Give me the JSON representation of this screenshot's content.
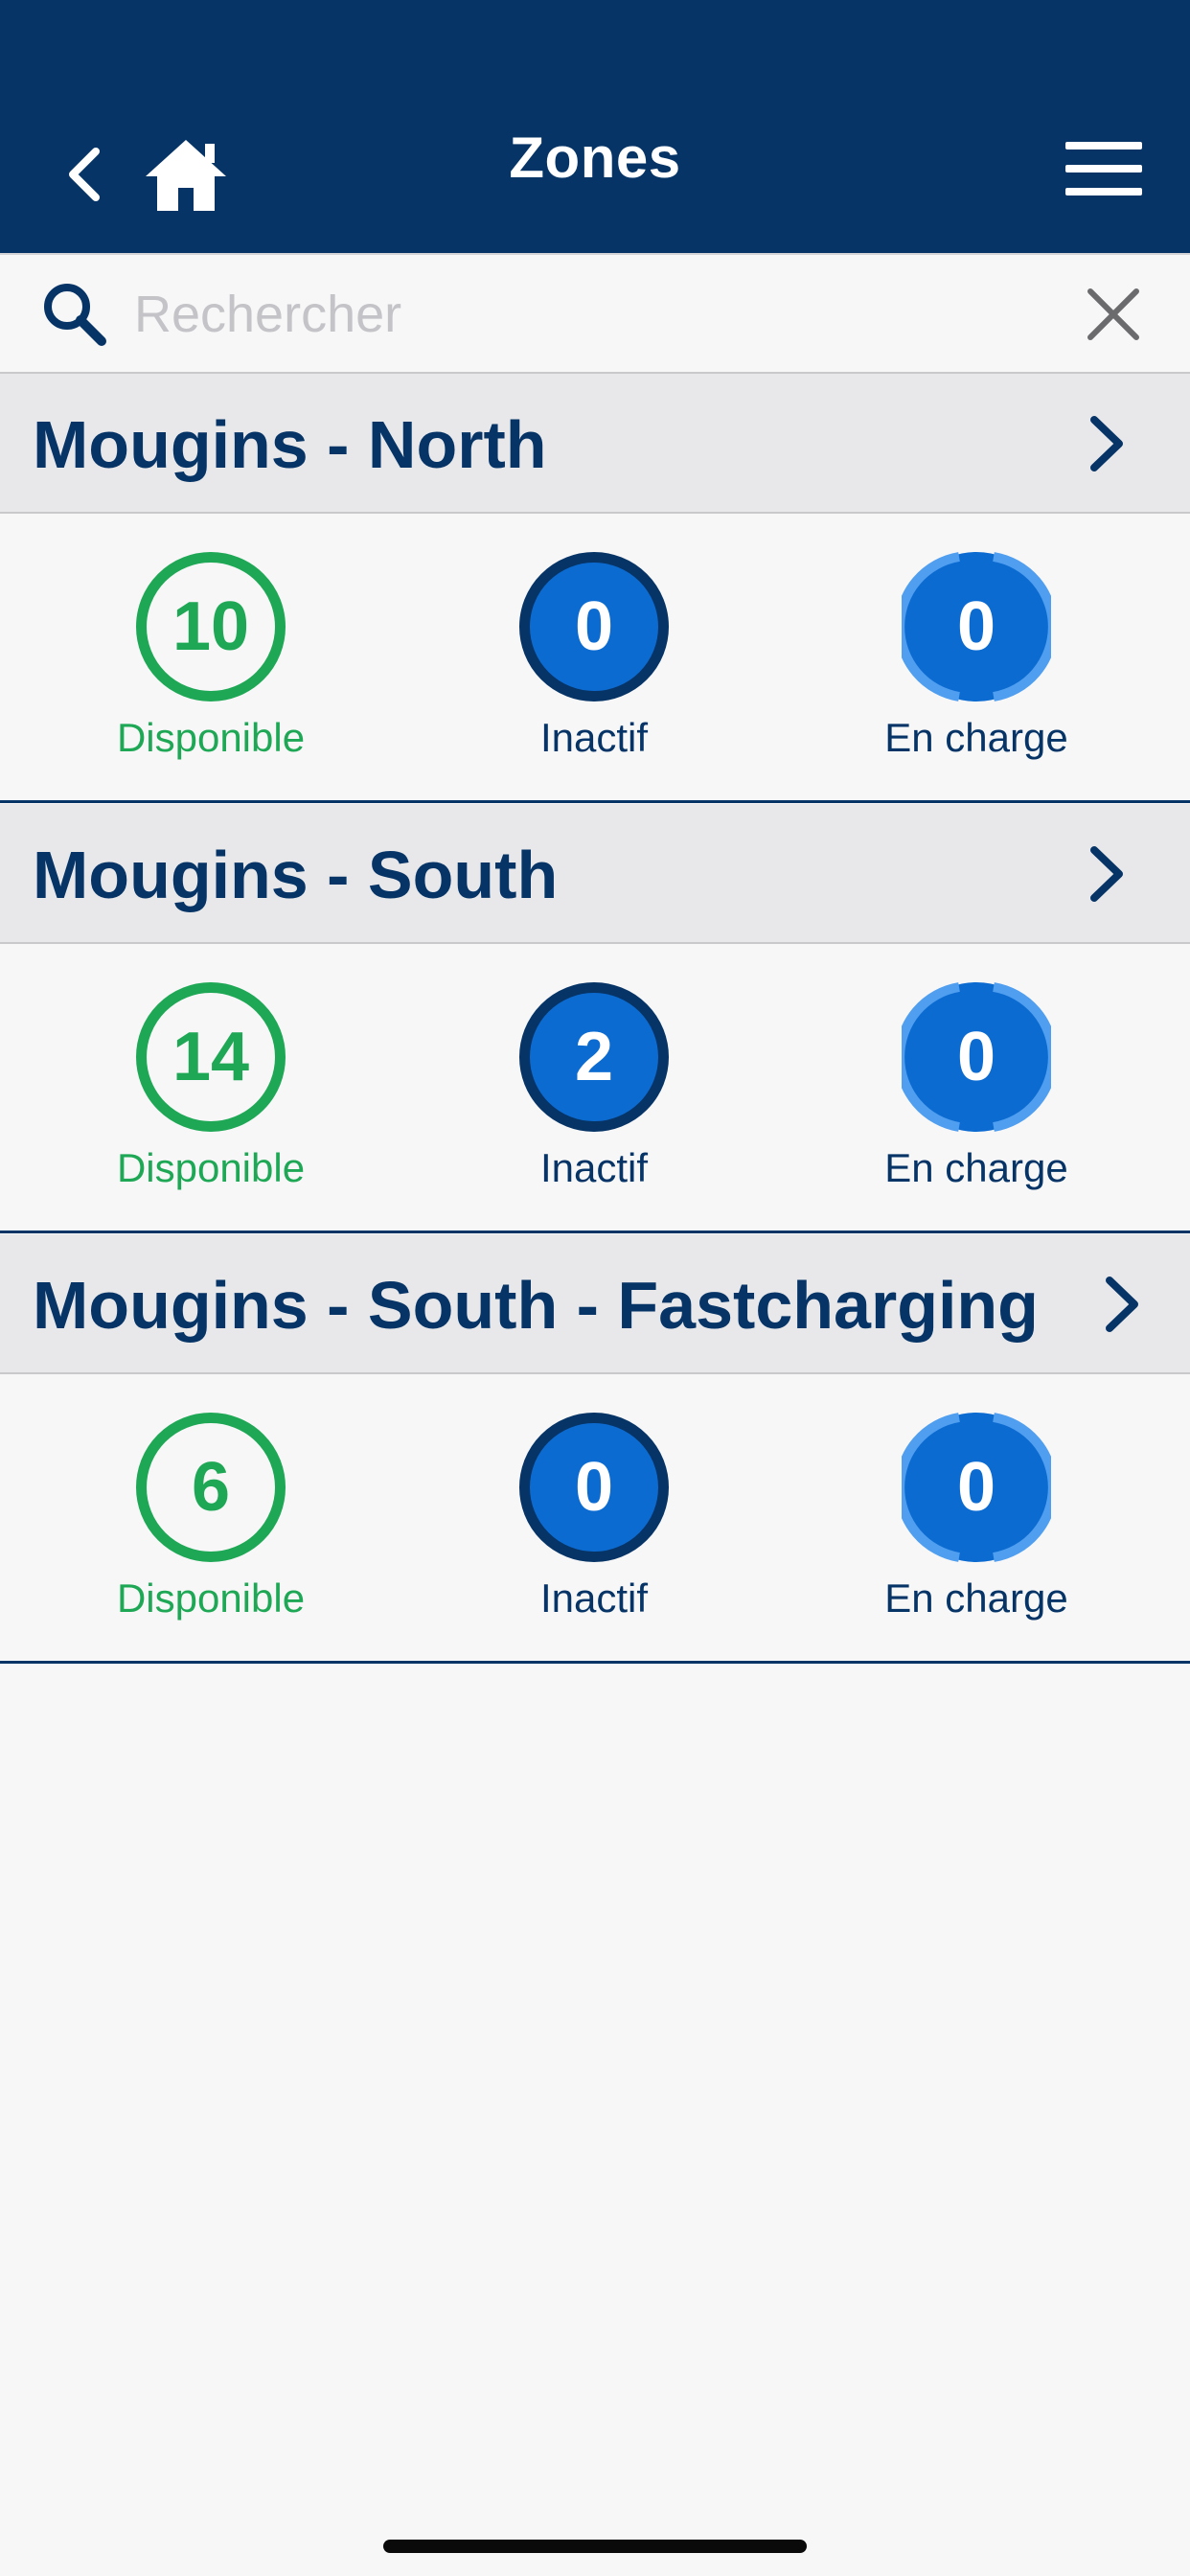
{
  "header": {
    "title": "Zones"
  },
  "search": {
    "placeholder": "Rechercher",
    "value": ""
  },
  "zones": [
    {
      "name": "Mougins - North",
      "stats": {
        "disponible": "10",
        "inactif": "0",
        "en_charge": "0"
      }
    },
    {
      "name": "Mougins - South",
      "stats": {
        "disponible": "14",
        "inactif": "2",
        "en_charge": "0"
      }
    },
    {
      "name": "Mougins - South - Fastcharging",
      "stats": {
        "disponible": "6",
        "inactif": "0",
        "en_charge": "0"
      }
    }
  ],
  "labels": {
    "disponible": "Disponible",
    "inactif": "Inactif",
    "en_charge": "En charge"
  },
  "colors": {
    "header_bg": "#063466",
    "available_green": "#1ea855",
    "active_blue": "#0c6bd1",
    "charging_ring": "#4f9ef0"
  }
}
